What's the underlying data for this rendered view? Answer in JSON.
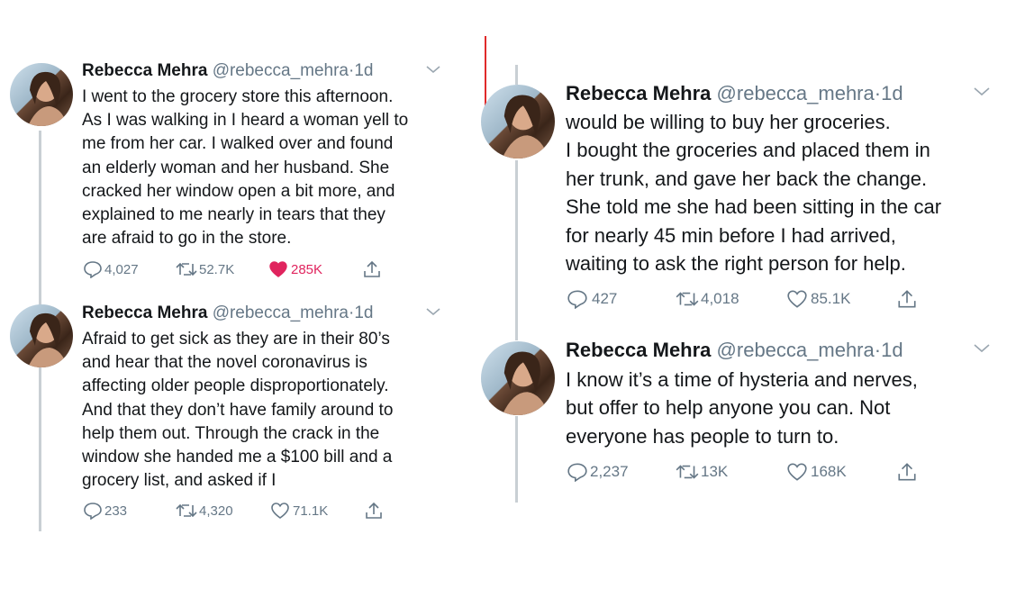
{
  "author": {
    "name": "Rebecca Mehra",
    "handle": "@rebecca_mehra",
    "dot": "·",
    "age": "1d"
  },
  "colors": {
    "text": "#14171a",
    "muted": "#657786",
    "like_active": "#e0245e",
    "thread": "#c9cfd4",
    "annotation": "#e02a2a"
  },
  "icons": {
    "reply": "reply-icon",
    "retweet": "retweet-icon",
    "like": "heart-icon",
    "share": "share-icon",
    "menu": "chevron-down-icon"
  },
  "tweets": [
    {
      "lines": [
        "I went to the grocery store this afternoon.",
        "As I was walking in I heard a woman yell to",
        "me from her car. I walked over and found",
        "an elderly woman and her husband. She",
        "cracked her window open a bit more, and",
        "explained to me nearly in tears that they",
        "are afraid to go in the store."
      ],
      "replies": "4,027",
      "retweets": "52.7K",
      "likes": "285K",
      "liked": true
    },
    {
      "lines": [
        "Afraid to get sick as they are in their 80’s",
        "and hear that the novel coronavirus is",
        "affecting older people disproportionately.",
        "And that they don’t have family around to",
        "help them out. Through the crack in the",
        "window she handed me a $100 bill and a",
        "grocery list, and asked if I"
      ],
      "replies": "233",
      "retweets": "4,320",
      "likes": "71.1K",
      "liked": false
    },
    {
      "lines": [
        "would be willing to buy her groceries.",
        "I bought the groceries and placed them in",
        "her trunk, and gave her back the change.",
        "She told me she had been sitting in the car",
        "for nearly 45 min before I had arrived,",
        "waiting to ask the right person for help."
      ],
      "replies": "427",
      "retweets": "4,018",
      "likes": "85.1K",
      "liked": false
    },
    {
      "lines": [
        "I know it’s a time of hysteria and nerves,",
        "but offer to help anyone you can. Not",
        "everyone has people to turn to."
      ],
      "replies": "2,237",
      "retweets": "13K",
      "likes": "168K",
      "liked": false
    }
  ]
}
